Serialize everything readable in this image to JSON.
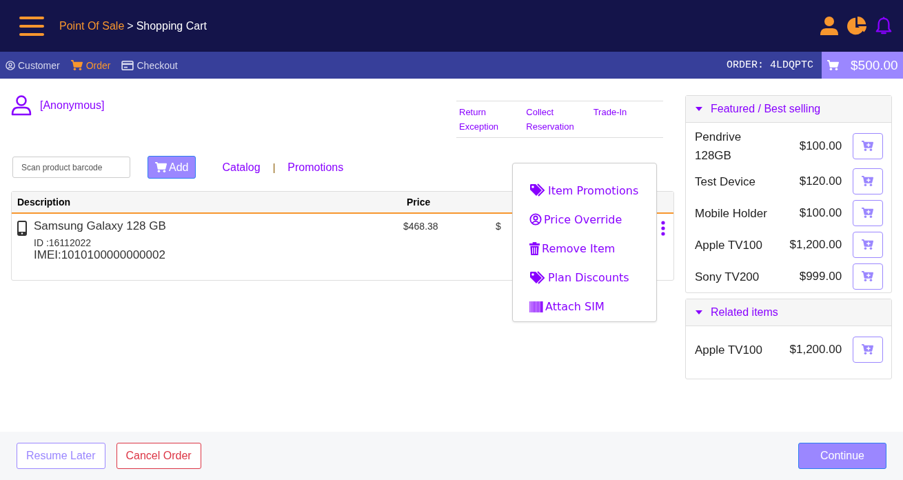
{
  "header": {
    "breadcrumb": [
      {
        "label": "Point Of Sale",
        "kind": "link"
      },
      {
        "label": ">",
        "kind": "separator"
      },
      {
        "label": "Shopping Cart",
        "kind": "current"
      }
    ]
  },
  "steps": [
    {
      "label": "Customer",
      "kind": "user",
      "selected": false
    },
    {
      "label": "Order",
      "kind": "cart",
      "selected": true
    },
    {
      "label": "Checkout",
      "kind": "card",
      "selected": false
    }
  ],
  "order": {
    "label": "ORDER: 4LDQPTC",
    "total": "$500.00"
  },
  "customer": {
    "name": "[Anonymous]"
  },
  "quick_links": [
    "Return Exception",
    "Collect Reservation",
    "Trade-In"
  ],
  "scan": {
    "placeholder": "Scan product barcode",
    "button": "Add"
  },
  "nav_links": [
    {
      "label": "Catalog",
      "kind": "link"
    },
    {
      "label": "|",
      "kind": "separator"
    },
    {
      "label": "Promotions",
      "kind": "link"
    }
  ],
  "cart_table": {
    "columns": [
      "Description",
      "Price"
    ],
    "rows": [
      {
        "name": "Samsung Galaxy 128 GB",
        "id": "ID :16112022",
        "imei": "IMEI:1010100000000002",
        "price": "$468.38",
        "column_3": "$"
      }
    ]
  },
  "item_menu": [
    {
      "label": "Item Promotions",
      "kind": "tag"
    },
    {
      "label": "Price Override",
      "kind": "user-circle"
    },
    {
      "label": "Remove Item",
      "kind": "trash"
    },
    {
      "label": "Plan Discounts",
      "kind": "tag"
    },
    {
      "label": "Attach SIM",
      "kind": "barcode"
    }
  ],
  "panels": [
    {
      "title": "Featured / Best selling",
      "expanded": true,
      "items": [
        {
          "name": "Pendrive 128GB",
          "price": "$100.00"
        },
        {
          "name": "Test Device",
          "price": "$120.00"
        },
        {
          "name": "Mobile Holder",
          "price": "$100.00"
        },
        {
          "name": "Apple TV100",
          "price": "$1,200.00"
        },
        {
          "name": "Sony TV200",
          "price": "$999.00"
        }
      ]
    },
    {
      "title": "Related items",
      "expanded": true,
      "items": [
        {
          "name": "Apple TV100",
          "price": "$1,200.00"
        }
      ]
    }
  ],
  "footer": {
    "buttons": [
      {
        "label": "Resume Later",
        "kind": "secondary"
      },
      {
        "label": "Cancel Order",
        "kind": "danger"
      },
      {
        "label": "Continue",
        "kind": "primary"
      }
    ]
  }
}
